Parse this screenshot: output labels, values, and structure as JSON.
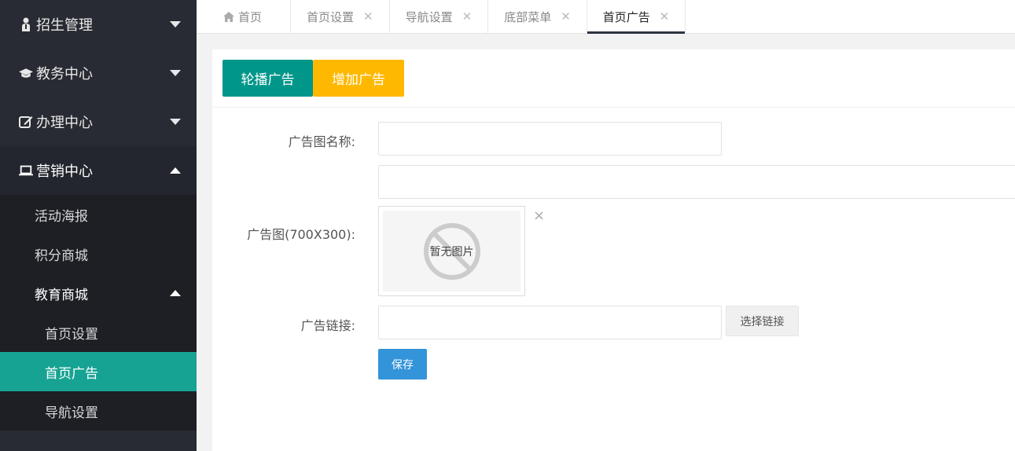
{
  "sidebar": {
    "groups": [
      {
        "label": "招生管理",
        "icon": "user-icon"
      },
      {
        "label": "教务中心",
        "icon": "graduation-cap-icon"
      },
      {
        "label": "办理中心",
        "icon": "edit-icon"
      },
      {
        "label": "营销中心",
        "icon": "laptop-icon"
      }
    ],
    "marketing_items": [
      {
        "label": "活动海报"
      },
      {
        "label": "积分商城"
      },
      {
        "label": "教育商城"
      }
    ],
    "edu_mall_items": [
      {
        "label": "首页设置"
      },
      {
        "label": "首页广告"
      },
      {
        "label": "导航设置"
      }
    ]
  },
  "tabs": [
    {
      "label": "首页",
      "icon": "home-icon"
    },
    {
      "label": "首页设置"
    },
    {
      "label": "导航设置"
    },
    {
      "label": "底部菜单"
    },
    {
      "label": "首页广告"
    }
  ],
  "card": {
    "carousel_btn": "轮播广告",
    "add_btn": "增加广告"
  },
  "form": {
    "name_label": "广告图名称:",
    "name_value": "",
    "second_value": "",
    "image_label": "广告图(700X300):",
    "no_image_text": "暂无图片",
    "remove_symbol": "×",
    "link_label": "广告链接:",
    "link_value": "",
    "select_link_btn": "选择链接",
    "save_btn": "保存"
  },
  "colors": {
    "sidebar_bg": "#282b33",
    "active_item": "#17a394",
    "carousel_btn": "#00968a",
    "add_btn": "#ffb800",
    "save_btn": "#3394d9"
  }
}
